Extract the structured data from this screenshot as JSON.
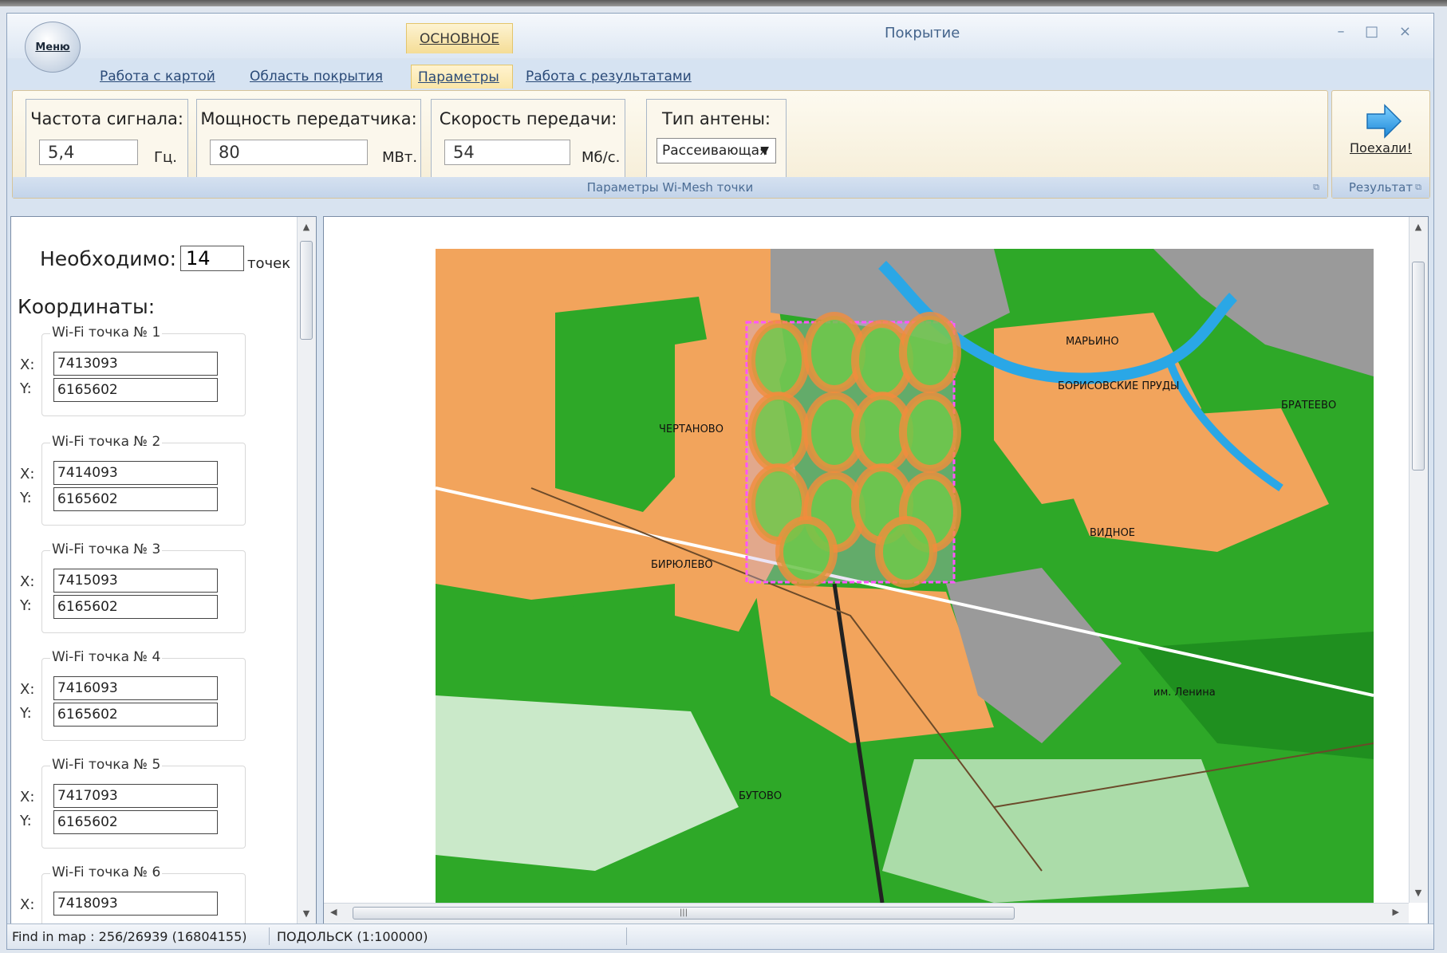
{
  "window": {
    "title": "Покрытие",
    "menu_label": "Меню",
    "context_tab": "ОСНОВНОЕ",
    "controls": "– □ ×"
  },
  "tabs": [
    {
      "label": "Работа с картой",
      "active": false
    },
    {
      "label": "Область покрытия",
      "active": false
    },
    {
      "label": "Параметры",
      "active": true
    },
    {
      "label": "Работа с результатами",
      "active": false
    }
  ],
  "ribbon": {
    "group_caption": "Параметры Wi-Mesh точки",
    "frequency": {
      "label": "Частота сигнала:",
      "value": "5,4",
      "unit": "Гц."
    },
    "power": {
      "label": "Мощность передатчика:",
      "value": "80",
      "unit": "МВт."
    },
    "speed": {
      "label": "Скорость передачи:",
      "value": "54",
      "unit": "Мб/с."
    },
    "antenna": {
      "label": "Тип антены:",
      "value": "Рассеивающая"
    },
    "result_caption": "Результат",
    "go_label": "Поехали!"
  },
  "left_panel": {
    "need_label": "Необходимо:",
    "need_value": "14",
    "need_unit": "точек",
    "coords_label": "Координаты:",
    "x_label": "X:",
    "y_label": "Y:",
    "points": [
      {
        "title": "Wi-Fi точка № 1",
        "x": "7413093",
        "y": "6165602"
      },
      {
        "title": "Wi-Fi точка № 2",
        "x": "7414093",
        "y": "6165602"
      },
      {
        "title": "Wi-Fi точка № 3",
        "x": "7415093",
        "y": "6165602"
      },
      {
        "title": "Wi-Fi точка № 4",
        "x": "7416093",
        "y": "6165602"
      },
      {
        "title": "Wi-Fi точка № 5",
        "x": "7417093",
        "y": "6165602"
      },
      {
        "title": "Wi-Fi точка № 6",
        "x": "7418093",
        "y": ""
      }
    ]
  },
  "map": {
    "labels": [
      "ЧЕРТАНОВО",
      "БИРЮЛЕВО",
      "МАРЬИНО",
      "БРАТЕЕВО",
      "БОРИСОВСКИЕ ПРУДЫ",
      "ВИДНОЕ",
      "БУТОВО",
      "им. Ленина"
    ]
  },
  "status": {
    "find": "Find in map : 256/26939 (16804155)",
    "map_name": "ПОДОЛЬСК (1:100000)"
  },
  "colors": {
    "ribbon_bg": "#f5ecd4",
    "tab_active": "#fae6a8",
    "caption_text": "#4b6c94",
    "map_orange": "#f2a45c",
    "map_green": "#2ea828",
    "map_gray": "#9a9a9a",
    "map_water": "#2aa7e6",
    "coverage_outline": "#ff55ff"
  }
}
